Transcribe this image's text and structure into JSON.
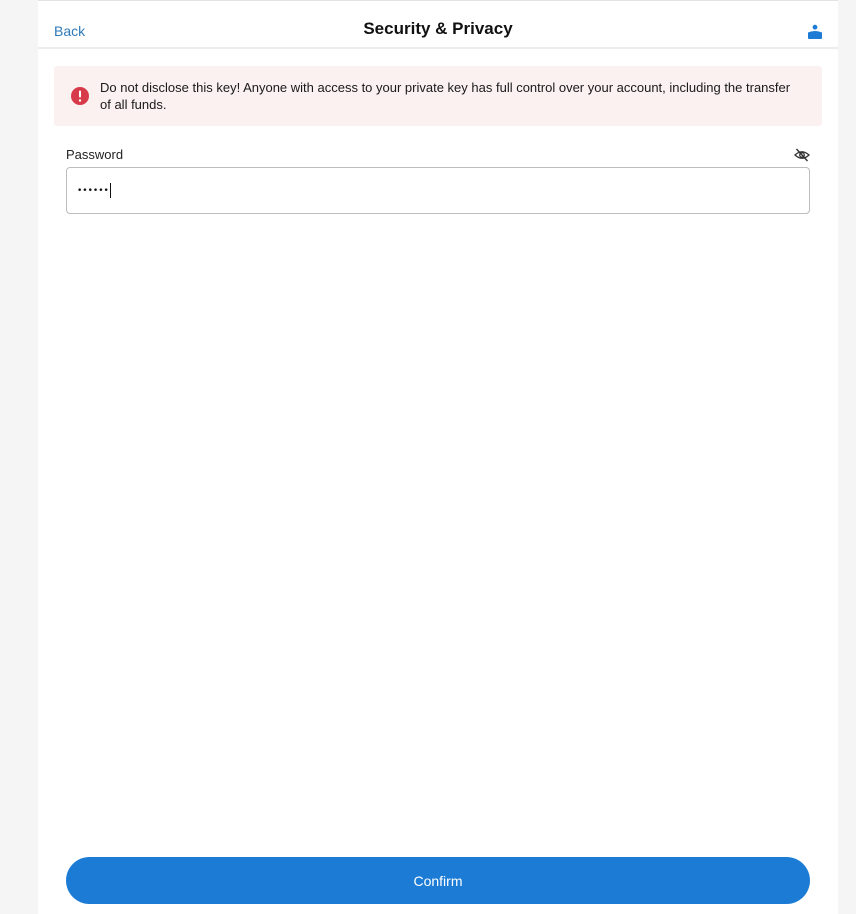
{
  "header": {
    "back_label": "Back",
    "title": "Security & Privacy",
    "account_icon": "user-account-icon"
  },
  "alert": {
    "icon": "exclamation-circle-icon",
    "text": "Do not disclose this key! Anyone with access to your private key has full control over your account, including the transfer of all funds.",
    "color": "#d73a49",
    "background": "#fbf1f1"
  },
  "password": {
    "label": "Password",
    "value_masked": "••••••",
    "toggle_icon": "eye-slash-icon"
  },
  "confirm": {
    "label": "Confirm",
    "color": "#1c7cd5"
  }
}
